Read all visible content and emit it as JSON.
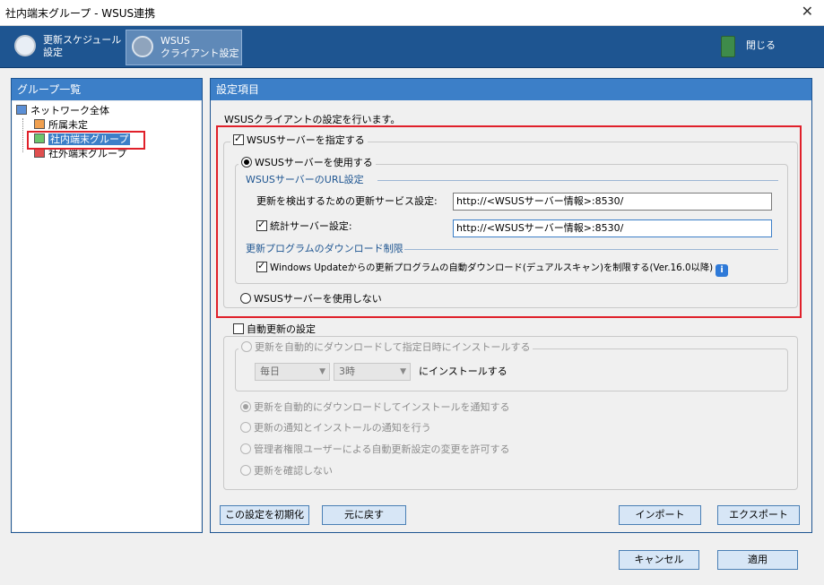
{
  "window": {
    "title": "社内端末グループ - WSUS連携",
    "close_glyph": "✕"
  },
  "toolbar": {
    "schedule_line1": "更新スケジュール",
    "schedule_line2": "設定",
    "wsus_line1": "WSUS",
    "wsus_line2": "クライアント設定",
    "close_label": "閉じる"
  },
  "left_panel": {
    "header": "グループ一覧",
    "tree": {
      "root": "ネットワーク全体",
      "children": [
        "所属未定",
        "社内端末グループ",
        "社外端末グループ"
      ],
      "selected": "社内端末グループ"
    }
  },
  "right_panel": {
    "header": "設定項目",
    "description": "WSUSクライアントの設定を行います。",
    "wsus": {
      "checkbox_label": "WSUSサーバーを指定する",
      "checked": true,
      "use_label": "WSUSサーバーを使用する",
      "url_section": "WSUSサーバーのURL設定",
      "detect_label": "更新を検出するための更新サービス設定:",
      "detect_value": "http://<WSUSサーバー情報>:8530/",
      "stats_label": "統計サーバー設定:",
      "stats_checked": true,
      "stats_value": "http://<WSUSサーバー情報>:8530/",
      "download_section": "更新プログラムのダウンロード制限",
      "dual_scan_label": "Windows Updateからの更新プログラムの自動ダウンロード(デュアルスキャン)を制限する(Ver.16.0以降)",
      "dual_scan_checked": true,
      "info_glyph": "i",
      "no_use_label": "WSUSサーバーを使用しない"
    },
    "auto_update": {
      "checkbox_label": "自動更新の設定",
      "checked": false,
      "option_schedule": "更新を自動的にダウンロードして指定日時にインストールする",
      "day_value": "毎日",
      "time_value": "3時",
      "install_suffix": "にインストールする",
      "option_notify_install": "更新を自動的にダウンロードしてインストールを通知する",
      "option_notify_both": "更新の通知とインストールの通知を行う",
      "option_admin": "管理者権限ユーザーによる自動更新設定の変更を許可する",
      "option_none": "更新を確認しない"
    },
    "buttons": {
      "reset": "この設定を初期化",
      "revert": "元に戻す",
      "import": "インポート",
      "export": "エクスポート"
    }
  },
  "footer": {
    "cancel": "キャンセル",
    "apply": "適用"
  },
  "colors": {
    "accent": "#1e5591",
    "header": "#3c7fc8",
    "highlight_red": "#e0202a"
  }
}
